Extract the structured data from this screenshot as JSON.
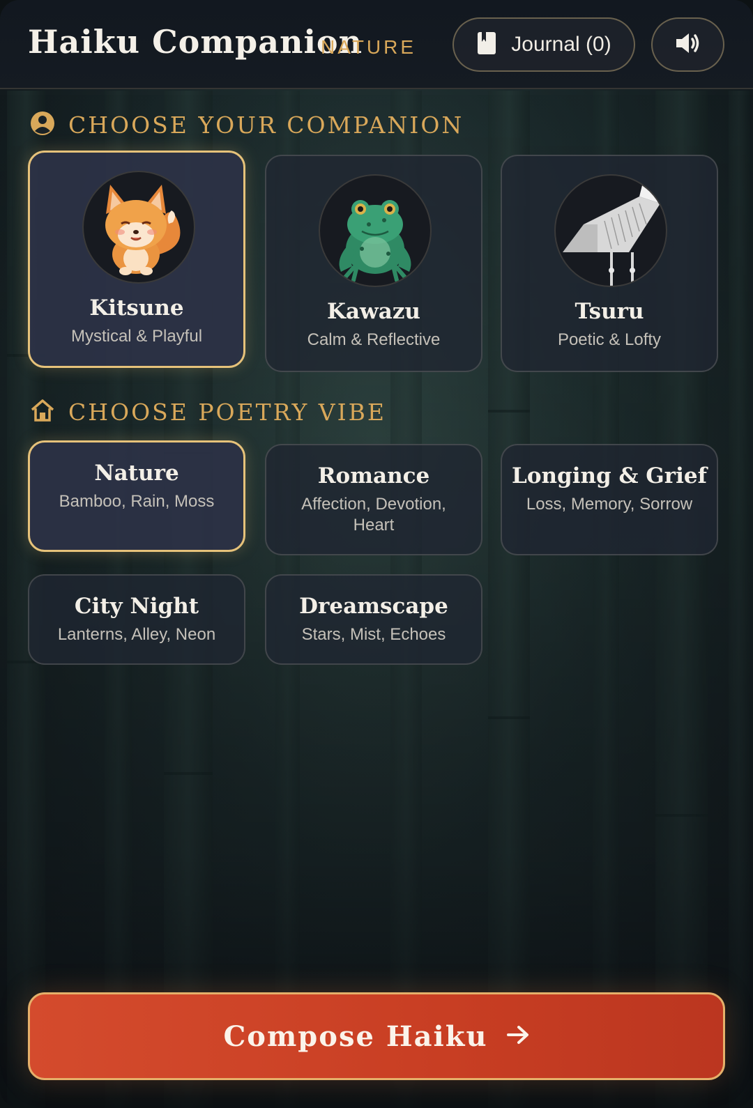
{
  "header": {
    "title": "Haiku Companion",
    "subtitle": "NATURE",
    "journal_label": "Journal (0)"
  },
  "companion_section": {
    "title": "CHOOSE YOUR COMPANION",
    "items": [
      {
        "name": "Kitsune",
        "desc": "Mystical & Playful",
        "selected": true
      },
      {
        "name": "Kawazu",
        "desc": "Calm & Reflective",
        "selected": false
      },
      {
        "name": "Tsuru",
        "desc": "Poetic & Lofty",
        "selected": false
      }
    ]
  },
  "vibe_section": {
    "title": "CHOOSE POETRY VIBE",
    "items": [
      {
        "name": "Nature",
        "desc": "Bamboo, Rain, Moss",
        "selected": true
      },
      {
        "name": "Romance",
        "desc": "Affection, Devotion, Heart",
        "selected": false
      },
      {
        "name": "Longing & Grief",
        "desc": "Loss, Memory, Sorrow",
        "selected": false
      },
      {
        "name": "City Night",
        "desc": "Lanterns, Alley, Neon",
        "selected": false
      },
      {
        "name": "Dreamscape",
        "desc": "Stars, Mist, Echoes",
        "selected": false
      }
    ]
  },
  "compose_button": {
    "label": "Compose Haiku"
  },
  "icons": {
    "journal": "book-icon",
    "sound": "speaker-icon",
    "companion": "user-circle-icon",
    "vibe": "home-icon",
    "compose": "arrow-right-icon"
  },
  "colors": {
    "accent_gold": "#d9a85a",
    "selected_border": "#e6c27a",
    "compose_bg": "#c83e23"
  }
}
